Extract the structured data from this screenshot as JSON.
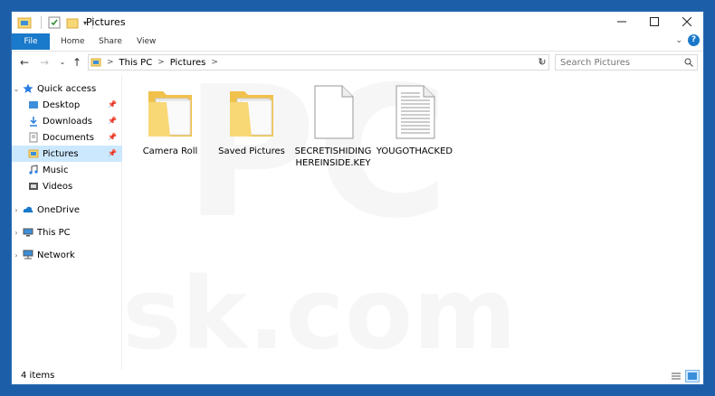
{
  "window": {
    "title": "Pictures"
  },
  "ribbon": {
    "tabs": [
      "File",
      "Home",
      "Share",
      "View"
    ],
    "help": "?"
  },
  "address": {
    "crumbs": [
      "This PC",
      "Pictures"
    ],
    "search_placeholder": "Search Pictures"
  },
  "nav": {
    "quick_access": "Quick access",
    "items": [
      "Desktop",
      "Downloads",
      "Documents",
      "Pictures",
      "Music",
      "Videos"
    ],
    "onedrive": "OneDrive",
    "this_pc": "This PC",
    "network": "Network"
  },
  "files": [
    {
      "name": "Camera Roll",
      "type": "folder"
    },
    {
      "name": "Saved Pictures",
      "type": "folder"
    },
    {
      "name": "SECRETISHIDING HEREINSIDE.KEY",
      "type": "blank-file"
    },
    {
      "name": "YOUGOTHACKED",
      "type": "text-file"
    }
  ],
  "status": {
    "count": "4 items"
  },
  "watermark": {
    "top": "PC",
    "bottom": "risk.com"
  },
  "colors": {
    "accent": "#1979ca",
    "selected": "#cce8ff",
    "folder": "#f8d775"
  }
}
